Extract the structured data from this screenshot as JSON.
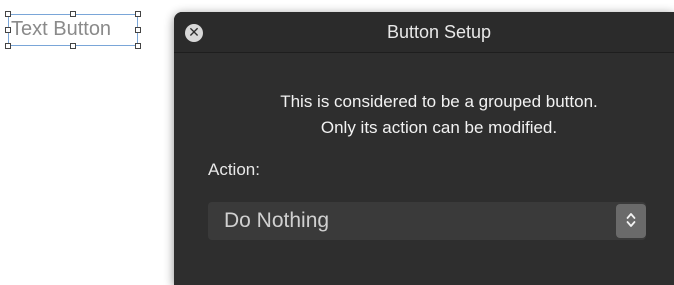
{
  "canvas": {
    "text_button": {
      "label": "Text Button"
    }
  },
  "dialog": {
    "title": "Button Setup",
    "close_icon": "close-icon",
    "message_line1": "This is considered to be a grouped button.",
    "message_line2": "Only its action can be modified.",
    "action_label": "Action:",
    "action_select": {
      "selected": "Do Nothing",
      "icon": "chevron-up-down-icon"
    }
  },
  "colors": {
    "dialog_background": "#2e2e2e",
    "selection_border": "#7aa6d8",
    "select_background": "#3a3a3a",
    "stepper_background": "#6a6a6a"
  }
}
